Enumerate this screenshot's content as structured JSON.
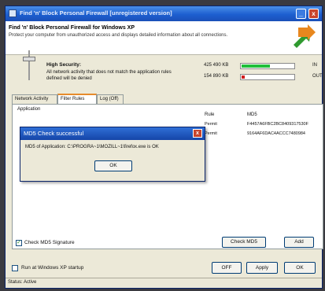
{
  "window": {
    "title": "Find 'n' Block Personal Firewall [unregistered version]",
    "min_label": "_",
    "close_label": "x"
  },
  "banner": {
    "heading": "Find 'n' Block Personal Firewall for Windows XP",
    "subtitle": "Protect your computer from unauthorized access and displays detailed information about all connections."
  },
  "security": {
    "level": "High Security:",
    "description": "All network activity that does not match the application rules defined will be denied"
  },
  "traffic": {
    "in_value": "425 490 KB",
    "in_label": "IN",
    "in_fraction": 0.55,
    "out_value": "154 890 KB",
    "out_label": "OUT",
    "out_fraction": 0.06
  },
  "tabs": [
    {
      "label": "Network Activity"
    },
    {
      "label": "Filter Rules"
    },
    {
      "label": "Log (Off)"
    }
  ],
  "table": {
    "columns": {
      "application": "Application",
      "rule": "Rule",
      "md5": "MD5"
    },
    "rows": [
      {
        "rule": "Permit",
        "md5": "F4457A6FBC2BC8409317530F"
      },
      {
        "rule": "Permit",
        "md5": "9164AF6DAC4ACCC7480984"
      }
    ]
  },
  "dialog": {
    "title": "MD5 Check successful",
    "message": "MD5 of Application: C:\\PROGRA~1\\MOZILL~1\\firefox.exe is OK",
    "ok_label": "OK",
    "close_label": "x"
  },
  "check_md5": {
    "label": "Check MD5 Signature",
    "checked": true
  },
  "buttons": {
    "check_md5": "Check MD5",
    "add": "Add",
    "off": "OFF",
    "apply": "Apply",
    "ok": "OK"
  },
  "startup": {
    "label": "Run at Windows XP startup",
    "checked": false
  },
  "status": "Status: Active",
  "colors": {
    "in_meter": "#1fbf3a",
    "out_meter": "#d11d1d",
    "title_bar": "#1d5fd0",
    "dialog_close": "#c8452c"
  }
}
